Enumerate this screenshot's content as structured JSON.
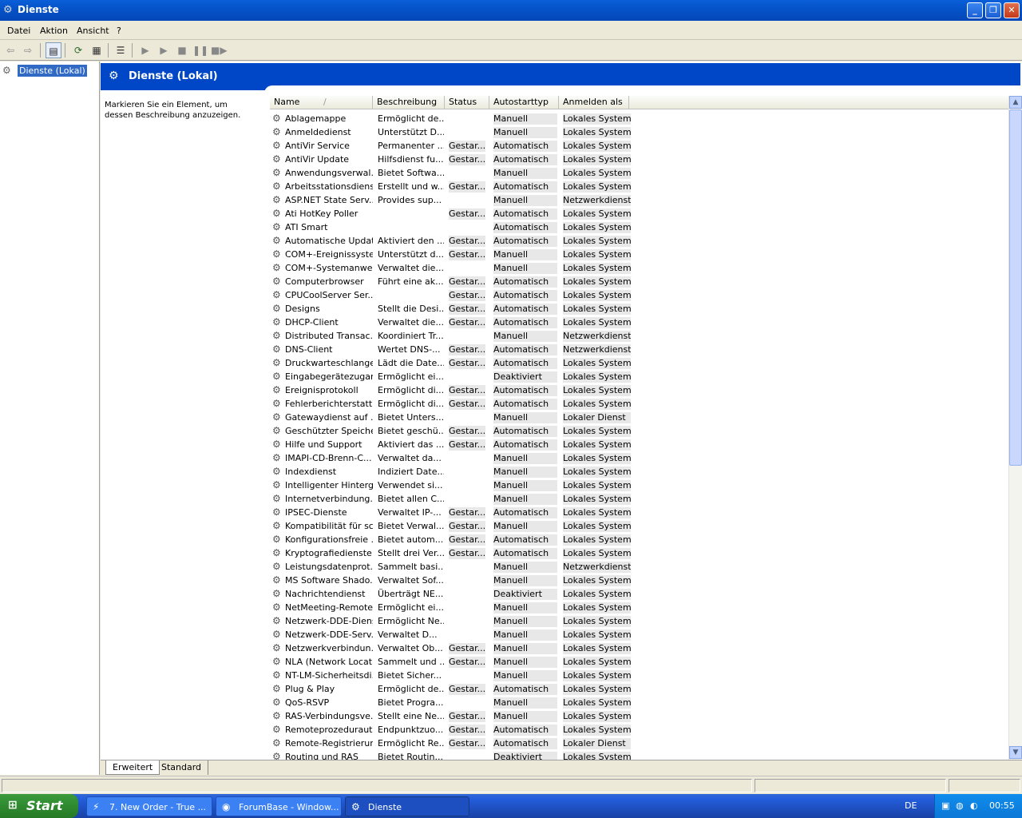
{
  "window": {
    "title": "Dienste",
    "icon": "gear-icon"
  },
  "menu": {
    "items": [
      "Datei",
      "Aktion",
      "Ansicht",
      "?"
    ]
  },
  "toolbar": {
    "icons": [
      "back-arrow-icon",
      "forward-arrow-icon",
      "show-hide-console-tree-icon",
      "refresh-icon",
      "export-list-icon",
      "properties-icon",
      "start-service-icon",
      "start-service-2-icon",
      "stop-service-icon",
      "pause-service-icon",
      "restart-service-icon"
    ]
  },
  "tree": {
    "root_label": "Dienste (Lokal)"
  },
  "panel": {
    "title": "Dienste (Lokal)",
    "description": "Markieren Sie ein Element, um dessen Beschreibung anzuzeigen."
  },
  "columns": {
    "name": "Name",
    "description": "Beschreibung",
    "status": "Status",
    "startup": "Autostarttyp",
    "logon": "Anmelden als",
    "sort_indicator": "/"
  },
  "services": [
    {
      "name": "Ablagemappe",
      "desc": "Ermöglicht de...",
      "status": "",
      "startup": "Manuell",
      "logon": "Lokales System"
    },
    {
      "name": "Anmeldedienst",
      "desc": "Unterstützt D...",
      "status": "",
      "startup": "Manuell",
      "logon": "Lokales System"
    },
    {
      "name": "AntiVir Service",
      "desc": "Permanenter ...",
      "status": "Gestar...",
      "startup": "Automatisch",
      "logon": "Lokales System"
    },
    {
      "name": "AntiVir Update",
      "desc": "Hilfsdienst fu...",
      "status": "Gestar...",
      "startup": "Automatisch",
      "logon": "Lokales System"
    },
    {
      "name": "Anwendungsverwal...",
      "desc": "Bietet Softwa...",
      "status": "",
      "startup": "Manuell",
      "logon": "Lokales System"
    },
    {
      "name": "Arbeitsstationsdienst",
      "desc": "Erstellt und w...",
      "status": "Gestar...",
      "startup": "Automatisch",
      "logon": "Lokales System"
    },
    {
      "name": "ASP.NET State Serv...",
      "desc": "Provides sup...",
      "status": "",
      "startup": "Manuell",
      "logon": "Netzwerkdienst"
    },
    {
      "name": "Ati HotKey Poller",
      "desc": "",
      "status": "Gestar...",
      "startup": "Automatisch",
      "logon": "Lokales System"
    },
    {
      "name": "ATI Smart",
      "desc": "",
      "status": "",
      "startup": "Automatisch",
      "logon": "Lokales System"
    },
    {
      "name": "Automatische Updates",
      "desc": "Aktiviert den ...",
      "status": "Gestar...",
      "startup": "Automatisch",
      "logon": "Lokales System"
    },
    {
      "name": "COM+-Ereignissystem",
      "desc": "Unterstützt d...",
      "status": "Gestar...",
      "startup": "Manuell",
      "logon": "Lokales System"
    },
    {
      "name": "COM+-Systemanwe...",
      "desc": "Verwaltet die...",
      "status": "",
      "startup": "Manuell",
      "logon": "Lokales System"
    },
    {
      "name": "Computerbrowser",
      "desc": "Führt eine ak...",
      "status": "Gestar...",
      "startup": "Automatisch",
      "logon": "Lokales System"
    },
    {
      "name": "CPUCoolServer Ser...",
      "desc": "",
      "status": "Gestar...",
      "startup": "Automatisch",
      "logon": "Lokales System"
    },
    {
      "name": "Designs",
      "desc": "Stellt die Desi...",
      "status": "Gestar...",
      "startup": "Automatisch",
      "logon": "Lokales System"
    },
    {
      "name": "DHCP-Client",
      "desc": "Verwaltet die...",
      "status": "Gestar...",
      "startup": "Automatisch",
      "logon": "Lokales System"
    },
    {
      "name": "Distributed Transac...",
      "desc": "Koordiniert Tr...",
      "status": "",
      "startup": "Manuell",
      "logon": "Netzwerkdienst"
    },
    {
      "name": "DNS-Client",
      "desc": "Wertet DNS-...",
      "status": "Gestar...",
      "startup": "Automatisch",
      "logon": "Netzwerkdienst"
    },
    {
      "name": "Druckwarteschlange",
      "desc": "Lädt die Date...",
      "status": "Gestar...",
      "startup": "Automatisch",
      "logon": "Lokales System"
    },
    {
      "name": "Eingabegerätezugang",
      "desc": "Ermöglicht ei...",
      "status": "",
      "startup": "Deaktiviert",
      "logon": "Lokales System"
    },
    {
      "name": "Ereignisprotokoll",
      "desc": "Ermöglicht di...",
      "status": "Gestar...",
      "startup": "Automatisch",
      "logon": "Lokales System"
    },
    {
      "name": "Fehlerberichterstatt...",
      "desc": "Ermöglicht di...",
      "status": "Gestar...",
      "startup": "Automatisch",
      "logon": "Lokales System"
    },
    {
      "name": "Gatewaydienst auf ...",
      "desc": "Bietet Unters...",
      "status": "",
      "startup": "Manuell",
      "logon": "Lokaler Dienst"
    },
    {
      "name": "Geschützter Speicher",
      "desc": "Bietet geschü...",
      "status": "Gestar...",
      "startup": "Automatisch",
      "logon": "Lokales System"
    },
    {
      "name": "Hilfe und Support",
      "desc": "Aktiviert das ...",
      "status": "Gestar...",
      "startup": "Automatisch",
      "logon": "Lokales System"
    },
    {
      "name": "IMAPI-CD-Brenn-C...",
      "desc": "Verwaltet da...",
      "status": "",
      "startup": "Manuell",
      "logon": "Lokales System"
    },
    {
      "name": "Indexdienst",
      "desc": "Indiziert Date...",
      "status": "",
      "startup": "Manuell",
      "logon": "Lokales System"
    },
    {
      "name": "Intelligenter Hinterg...",
      "desc": "Verwendet si...",
      "status": "",
      "startup": "Manuell",
      "logon": "Lokales System"
    },
    {
      "name": "Internetverbindung...",
      "desc": "Bietet allen C...",
      "status": "",
      "startup": "Manuell",
      "logon": "Lokales System"
    },
    {
      "name": "IPSEC-Dienste",
      "desc": "Verwaltet IP-...",
      "status": "Gestar...",
      "startup": "Automatisch",
      "logon": "Lokales System"
    },
    {
      "name": "Kompatibilität für sc...",
      "desc": "Bietet Verwal...",
      "status": "Gestar...",
      "startup": "Manuell",
      "logon": "Lokales System"
    },
    {
      "name": "Konfigurationsfreie ...",
      "desc": "Bietet autom...",
      "status": "Gestar...",
      "startup": "Automatisch",
      "logon": "Lokales System"
    },
    {
      "name": "Kryptografiedienste",
      "desc": "Stellt drei Ver...",
      "status": "Gestar...",
      "startup": "Automatisch",
      "logon": "Lokales System"
    },
    {
      "name": "Leistungsdatenprot...",
      "desc": "Sammelt basi...",
      "status": "",
      "startup": "Manuell",
      "logon": "Netzwerkdienst"
    },
    {
      "name": "MS Software Shado...",
      "desc": "Verwaltet Sof...",
      "status": "",
      "startup": "Manuell",
      "logon": "Lokales System"
    },
    {
      "name": "Nachrichtendienst",
      "desc": "Überträgt NE...",
      "status": "",
      "startup": "Deaktiviert",
      "logon": "Lokales System"
    },
    {
      "name": "NetMeeting-Remote...",
      "desc": "Ermöglicht ei...",
      "status": "",
      "startup": "Manuell",
      "logon": "Lokales System"
    },
    {
      "name": "Netzwerk-DDE-Dienst",
      "desc": "Ermöglicht Ne...",
      "status": "",
      "startup": "Manuell",
      "logon": "Lokales System"
    },
    {
      "name": "Netzwerk-DDE-Serv...",
      "desc": "Verwaltet  D...",
      "status": "",
      "startup": "Manuell",
      "logon": "Lokales System"
    },
    {
      "name": "Netzwerkverbindun...",
      "desc": "Verwaltet Ob...",
      "status": "Gestar...",
      "startup": "Manuell",
      "logon": "Lokales System"
    },
    {
      "name": "NLA (Network Locat...",
      "desc": "Sammelt und ...",
      "status": "Gestar...",
      "startup": "Manuell",
      "logon": "Lokales System"
    },
    {
      "name": "NT-LM-Sicherheitsdi...",
      "desc": "Bietet Sicher...",
      "status": "",
      "startup": "Manuell",
      "logon": "Lokales System"
    },
    {
      "name": "Plug & Play",
      "desc": "Ermöglicht de...",
      "status": "Gestar...",
      "startup": "Automatisch",
      "logon": "Lokales System"
    },
    {
      "name": "QoS-RSVP",
      "desc": "Bietet Progra...",
      "status": "",
      "startup": "Manuell",
      "logon": "Lokales System"
    },
    {
      "name": "RAS-Verbindungsve...",
      "desc": "Stellt eine Ne...",
      "status": "Gestar...",
      "startup": "Manuell",
      "logon": "Lokales System"
    },
    {
      "name": "Remoteprozeduraut...",
      "desc": "Endpunktzuo...",
      "status": "Gestar...",
      "startup": "Automatisch",
      "logon": "Lokales System"
    },
    {
      "name": "Remote-Registrierung",
      "desc": "Ermöglicht Re...",
      "status": "Gestar...",
      "startup": "Automatisch",
      "logon": "Lokaler Dienst"
    },
    {
      "name": "Routing und RAS",
      "desc": "Bietet Routin...",
      "status": "",
      "startup": "Deaktiviert",
      "logon": "Lokales System"
    }
  ],
  "tabs": [
    "Erweitert",
    "Standard"
  ],
  "taskbar": {
    "start_label": "Start",
    "tasks": [
      {
        "label": "7. New Order - True ...",
        "icon": "winamp-icon"
      },
      {
        "label": "ForumBase - Window...",
        "icon": "firefox-icon"
      },
      {
        "label": "Dienste",
        "icon": "gear-icon"
      }
    ],
    "language": "DE",
    "clock": "00:55"
  }
}
